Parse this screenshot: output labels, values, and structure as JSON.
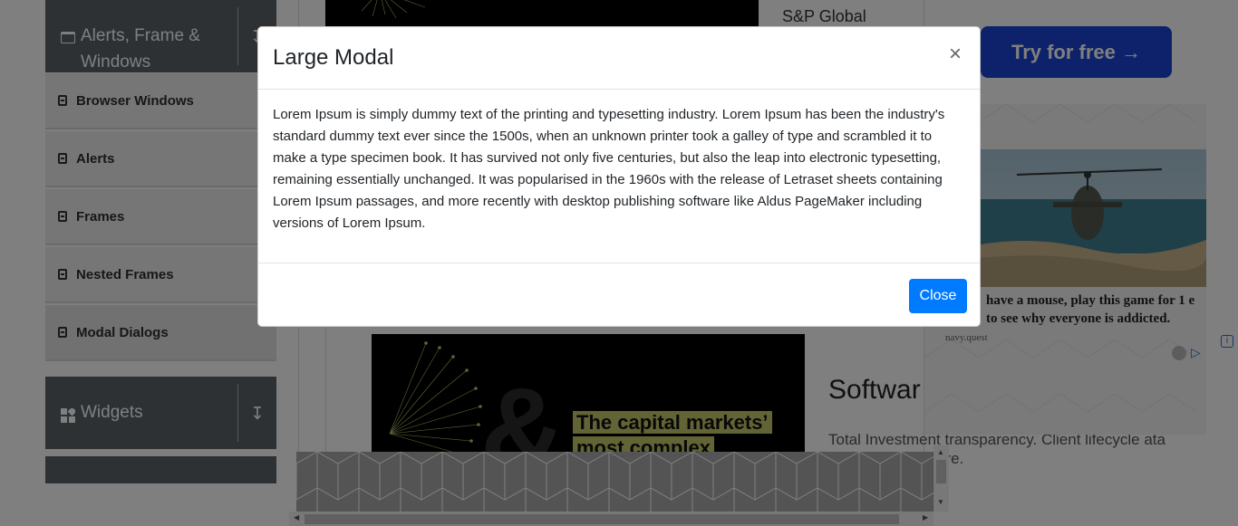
{
  "sidebar": {
    "group_alerts": "Alerts, Frame & Windows",
    "items": [
      {
        "label": "Browser Windows"
      },
      {
        "label": "Alerts"
      },
      {
        "label": "Frames"
      },
      {
        "label": "Nested Frames"
      },
      {
        "label": "Modal Dialogs"
      }
    ],
    "group_widgets": "Widgets"
  },
  "background": {
    "sp_global": "S&P Global",
    "try_free": "Try for free →",
    "capital_line1": "The capital markets’",
    "capital_line2": "most complex",
    "software": "Softwar",
    "total_text": "Total Investment transparency. Client lifecycle ata silos. Explore more.",
    "heli_caption": "have a mouse, play this game for 1 e to see why everyone is addicted.",
    "navy_quest": "navy.quest"
  },
  "modal": {
    "title": "Large Modal",
    "close_symbol": "×",
    "body": "Lorem Ipsum is simply dummy text of the printing and typesetting industry. Lorem Ipsum has been the industry's standard dummy text ever since the 1500s, when an unknown printer took a galley of type and scrambled it to make a type specimen book. It has survived not only five centuries, but also the leap into electronic typesetting, remaining essentially unchanged. It was popularised in the 1960s with the release of Letraset sheets containing Lorem Ipsum passages, and more recently with desktop publishing software like Aldus PageMaker including versions of Lorem Ipsum.",
    "close_button": "Close"
  },
  "colors": {
    "primary": "#007bff",
    "sidebar_header": "#5a6269",
    "backdrop": "rgba(0,0,0,0.5)"
  }
}
